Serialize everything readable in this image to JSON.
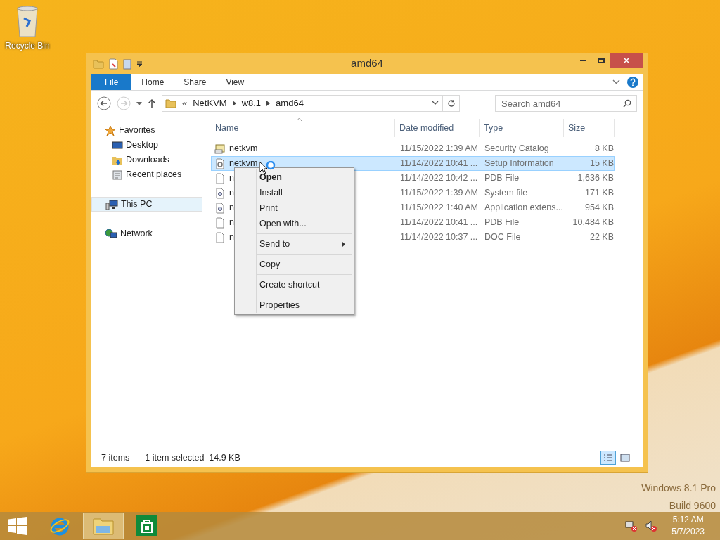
{
  "desktop": {
    "icons": [
      {
        "label": "Recycle Bin"
      }
    ],
    "watermark": [
      "Windows 8.1 Pro",
      "Build 9600"
    ]
  },
  "window": {
    "title": "amd64"
  },
  "ribbon": {
    "tabs": [
      {
        "label": "File",
        "selected": true
      },
      {
        "label": "Home",
        "selected": false
      },
      {
        "label": "Share",
        "selected": false
      },
      {
        "label": "View",
        "selected": false
      }
    ]
  },
  "address_bar": {
    "path": [
      "NetKVM",
      "w8.1",
      "amd64"
    ],
    "overflow": "«"
  },
  "search": {
    "placeholder": "Search amd64"
  },
  "sidebar": {
    "items": [
      {
        "label": "Favorites",
        "kind": "group",
        "selected": false,
        "children": [
          {
            "label": "Desktop",
            "kind": "desktop",
            "selected": false
          },
          {
            "label": "Downloads",
            "kind": "downloads",
            "selected": false
          },
          {
            "label": "Recent places",
            "kind": "recent",
            "selected": false
          }
        ]
      },
      {
        "label": "This PC",
        "kind": "pc",
        "selected": true
      },
      {
        "label": "Network",
        "kind": "network",
        "selected": false
      }
    ]
  },
  "table": {
    "columns": [
      "Name",
      "Date modified",
      "Type",
      "Size"
    ],
    "rows": [
      {
        "name": "netkvm",
        "date": "11/15/2022 1:39 AM",
        "type": "Security Catalog",
        "size": "8 KB",
        "kind": "catalog",
        "selected": false
      },
      {
        "name": "netkvm",
        "date": "11/14/2022 10:41 ...",
        "type": "Setup Information",
        "size": "15 KB",
        "kind": "setup",
        "selected": true
      },
      {
        "name": "n",
        "date": "11/14/2022 10:42 ...",
        "type": "PDB File",
        "size": "1,636 KB",
        "kind": "file",
        "selected": false
      },
      {
        "name": "n",
        "date": "11/15/2022 1:39 AM",
        "type": "System file",
        "size": "171 KB",
        "kind": "system",
        "selected": false
      },
      {
        "name": "n",
        "date": "11/15/2022 1:40 AM",
        "type": "Application extens...",
        "size": "954 KB",
        "kind": "system",
        "selected": false
      },
      {
        "name": "n",
        "date": "11/14/2022 10:41 ...",
        "type": "PDB File",
        "size": "10,484 KB",
        "kind": "file",
        "selected": false
      },
      {
        "name": "n",
        "date": "11/14/2022 10:37 ...",
        "type": "DOC File",
        "size": "22 KB",
        "kind": "file",
        "selected": false
      }
    ]
  },
  "context_menu": {
    "groups": [
      [
        {
          "label": "Open",
          "default": true,
          "submenu": false
        },
        {
          "label": "Install",
          "default": false,
          "submenu": false
        },
        {
          "label": "Print",
          "default": false,
          "submenu": false
        },
        {
          "label": "Open with...",
          "default": false,
          "submenu": false
        }
      ],
      [
        {
          "label": "Send to",
          "default": false,
          "submenu": true
        }
      ],
      [
        {
          "label": "Copy",
          "default": false,
          "submenu": false
        }
      ],
      [
        {
          "label": "Create shortcut",
          "default": false,
          "submenu": false
        }
      ],
      [
        {
          "label": "Properties",
          "default": false,
          "submenu": false
        }
      ]
    ]
  },
  "status_bar": {
    "count": "7 items",
    "selection": "1 item selected  14.9 KB",
    "views": [
      {
        "kind": "details",
        "selected": true
      },
      {
        "kind": "thumbnails",
        "selected": false
      }
    ]
  },
  "taskbar": {
    "apps": [
      {
        "kind": "ie",
        "selected": false
      },
      {
        "kind": "explorer",
        "selected": true
      },
      {
        "kind": "store",
        "selected": false
      }
    ],
    "time": "5:12 AM",
    "date": "5/7/2023"
  }
}
